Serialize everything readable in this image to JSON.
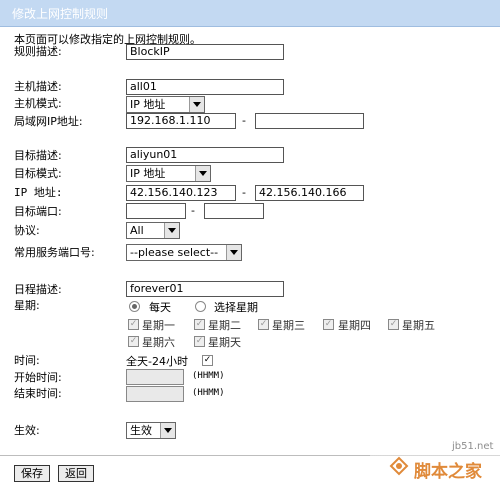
{
  "header": {
    "title": "修改上网控制规则"
  },
  "intro": "本页面可以修改指定的上网控制规则。",
  "rule": {
    "label": "规则描述:",
    "value": "BlockIP"
  },
  "host": {
    "desc_label": "主机描述:",
    "desc_value": "all01",
    "mode_label": "主机模式:",
    "mode_value": "IP 地址",
    "ip_label": "局域网IP地址:",
    "ip_start": "192.168.1.110",
    "ip_end": ""
  },
  "target": {
    "desc_label": "目标描述:",
    "desc_value": "aliyun01",
    "mode_label": "目标模式:",
    "mode_value": "IP 地址",
    "ip_label": "IP 地址:",
    "ip_start": "42.156.140.123",
    "ip_end": "42.156.140.166",
    "port_label": "目标端口:",
    "port_start": "",
    "port_end": "",
    "protocol_label": "协议:",
    "protocol_value": "All",
    "service_label": "常用服务端口号:",
    "service_value": "--please select--"
  },
  "schedule": {
    "desc_label": "日程描述:",
    "desc_value": "forever01",
    "week_label": "星期:",
    "radio_everyday": "每天",
    "radio_select": "选择星期",
    "days": [
      "星期一",
      "星期二",
      "星期三",
      "星期四",
      "星期五",
      "星期六",
      "星期天"
    ],
    "time_label": "时间:",
    "allday_text": "全天-24小时",
    "start_label": "开始时间:",
    "start_value": "",
    "start_hint": "(HHMM)",
    "end_label": "结束时间:",
    "end_value": "",
    "end_hint": "(HHMM)"
  },
  "effect": {
    "label": "生效:",
    "value": "生效"
  },
  "buttons": {
    "save": "保存",
    "back": "返回"
  },
  "watermark": {
    "site": "jb51.net",
    "brand": "脚本之家"
  },
  "colors": {
    "titlebar": "#c3d9f2",
    "watermark": "#e08a3a"
  }
}
